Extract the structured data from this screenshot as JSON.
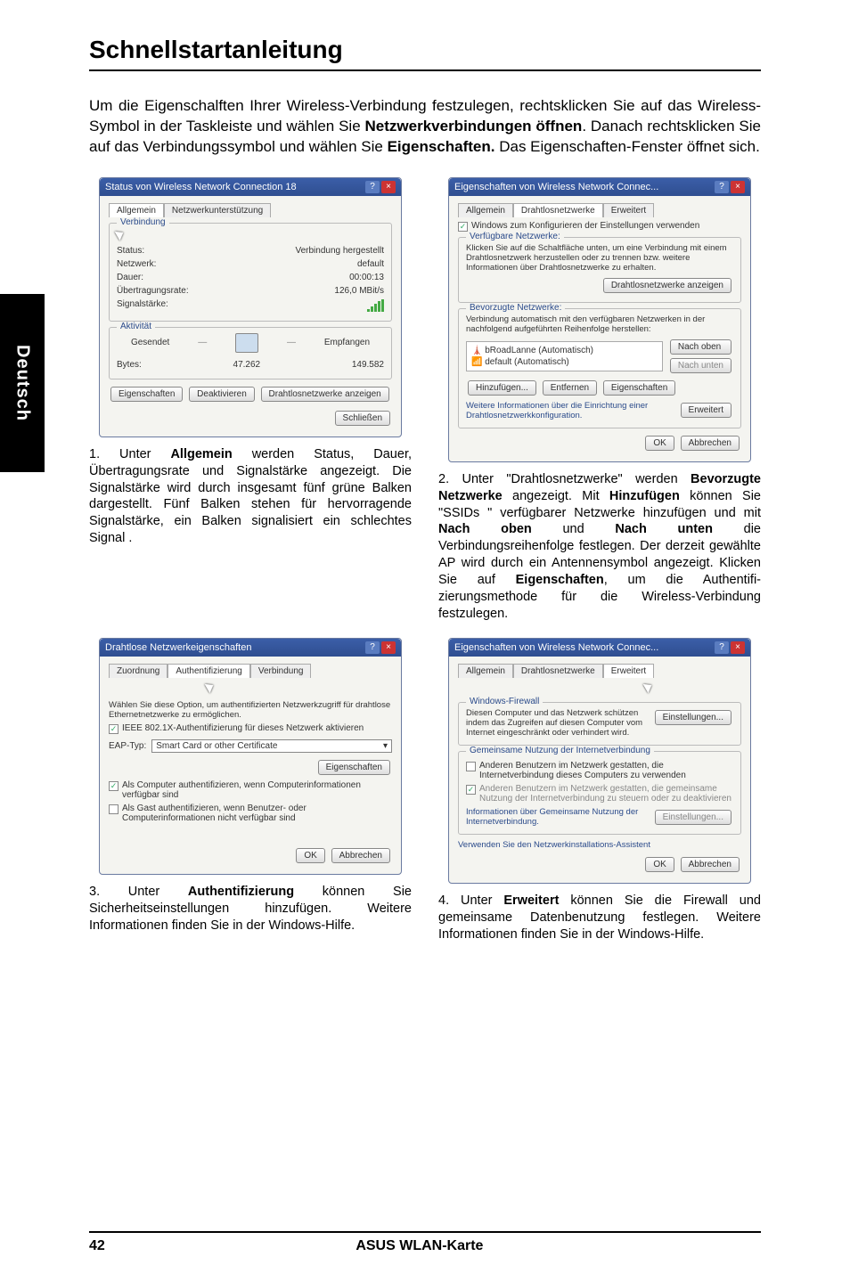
{
  "page": {
    "title": "Schnellstartanleitung",
    "sideTab": "Deutsch",
    "pageNumber": "42",
    "footerCenter": "ASUS WLAN-Karte"
  },
  "intro": {
    "p1_a": "Um die Eigenschalften Ihrer Wireless-Verbindung festzulegen, rechtsklicken Sie auf das Wireless-Symbol in der Taskleiste und wählen Sie ",
    "p1_b": "Netzwerk­verbindungen öffnen",
    "p1_c": ". Danach rechtsklicken Sie auf das Verbindungssymbol und wählen Sie ",
    "p1_d": "Eigenschaften.",
    "p1_e": " Das Eigenschaften-Fenster öffnet sich."
  },
  "dlg1": {
    "title": "Status von Wireless Network Connection 18",
    "tabs": [
      "Allgemein",
      "Netzwerkunterstützung"
    ],
    "group1": "Verbindung",
    "rows": {
      "statusL": "Status:",
      "statusV": "Verbindung hergestellt",
      "netL": "Netzwerk:",
      "netV": "default",
      "durL": "Dauer:",
      "durV": "00:00:13",
      "rateL": "Übertragungsrate:",
      "rateV": "126,0 MBit/s",
      "sigL": "Signalstärke:"
    },
    "group2": "Aktivität",
    "sent": "Gesendet",
    "recv": "Empfangen",
    "bytesL": "Bytes:",
    "bytesSent": "47.262",
    "bytesRecv": "149.582",
    "btns": {
      "props": "Eigenschaften",
      "disable": "Deaktivieren",
      "view": "Drahtlosnetzwerke anzeigen",
      "close": "Schließen"
    }
  },
  "cap1": {
    "num": "1. ",
    "a": "Unter ",
    "b": "Allgemein",
    "c": " werden Status, Dauer, Übertragungsrate und Signalstärke angezeigt. Die Signalstärke wird durch insgesamt fünf grüne Balken dargestellt. Fünf Balken stehen für hervorragende Signalstärke, ein Balken signalisiert ein schlechtes Signal ."
  },
  "dlg2": {
    "title": "Eigenschaften von Wireless Network Connec...",
    "tabs": [
      "Allgemein",
      "Drahtlosnetzwerke",
      "Erweitert"
    ],
    "chkTop": "Windows zum Konfigurieren der Einstellungen verwenden",
    "grpAvail": "Verfügbare Netzwerke:",
    "availText": "Klicken Sie auf die Schaltfläche unten, um eine Verbindung mit einem Drahtlosnetzwerk herzustellen oder zu trennen bzw. weitere Informationen über Drahtlosnetzwerke zu erhalten.",
    "btnView": "Drahtlosnetzwerke anzeigen",
    "grpPref": "Bevorzugte Netzwerke:",
    "prefText": "Verbindung automatisch mit den verfügbaren Netzwerken in der nachfolgend aufgeführten Reihenfolge herstellen:",
    "item1": "bRoadLanne (Automatisch)",
    "item2": "default (Automatisch)",
    "btnUp": "Nach oben",
    "btnDown": "Nach unten",
    "btnAdd": "Hinzufügen...",
    "btnRemove": "Entfernen",
    "btnProps": "Eigenschaften",
    "moreText": "Weitere Informationen über die Einrichtung einer Drahtlosnetzwerkkonfiguration.",
    "btnAdv": "Erweitert",
    "btnOk": "OK",
    "btnCancel": "Abbrechen"
  },
  "cap2": {
    "num": "2. ",
    "t": "Unter \"Drahtlosnetzwerke\" werden ",
    "b1": "Bevorzugte Netzwerke",
    "t2": " angezeigt. Mit ",
    "b2": "Hinzufügen",
    "t3": " können Sie \"SSIDs \" verfügbarer Netzwerke hinzufügen und mit ",
    "b3": "Nach oben",
    "t4": " und ",
    "b4": "Nach unten",
    "t5": " die Verbindungsreihenfolge festlegen. Der derzeit gewählte AP wird durch ein Antennensymbol angezeigt.  Klicken Sie auf ",
    "b5": "Eigenschaften",
    "t6": ", um die Authentifi­zierungsmethode für die Wireless-Verbindung festzulegen."
  },
  "dlg3": {
    "title": "Drahtlose Netzwerkeigenschaften",
    "tabs": [
      "Zuordnung",
      "Authentifizierung",
      "Verbindung"
    ],
    "line1": "Wählen Sie diese Option, um authentifizierten Netzwerkzugriff für drahtlose Ethernetnetzwerke zu ermöglichen.",
    "chk1": "IEEE 802.1X-Authentifizierung für dieses Netzwerk aktivieren",
    "eapL": "EAP-Typ:",
    "eapV": "Smart Card or other Certificate",
    "btnProps": "Eigenschaften",
    "chk2": "Als Computer authentifizieren, wenn Computerinformationen verfügbar sind",
    "chk3": "Als Gast authentifizieren, wenn Benutzer- oder Computerinformationen nicht verfügbar sind",
    "btnOk": "OK",
    "btnCancel": "Abbrechen"
  },
  "cap3": {
    "num": "3. ",
    "a": "Unter ",
    "b": "Authentifizierung",
    "c": " können Sie Sicherheitseinstellungen hinzufügen. Weitere Informationen finden Sie in der Windows-Hilfe."
  },
  "dlg4": {
    "title": "Eigenschaften von Wireless Network Connec...",
    "tabs": [
      "Allgemein",
      "Drahtlosnetzwerke",
      "Erweitert"
    ],
    "grpFw": "Windows-Firewall",
    "fwText": "Diesen Computer und das Netzwerk schützen indem das Zugreifen auf diesen Computer vom Internet eingeschränkt oder verhindert wird.",
    "btnFw": "Einstellungen...",
    "grpShare": "Gemeinsame Nutzung der Internetverbindung",
    "chkShare1": "Anderen Benutzern im Netzwerk gestatten, die Internetverbindung dieses Computers zu verwenden",
    "chkShare2": "Anderen Benutzern im Netzwerk gestatten, die gemeinsame Nutzung der Internetverbindung zu steuern oder zu deaktivieren",
    "linkMore": "Informationen über Gemeinsame Nutzung der Internetverbindung.",
    "btnSettings": "Einstellungen...",
    "linkWiz": "Verwenden Sie den Netzwerkinstallations-Assistent",
    "btnOk": "OK",
    "btnCancel": "Abbrechen"
  },
  "cap4": {
    "num": "4. ",
    "a": "Unter ",
    "b": "Erweitert",
    "c": " können Sie die Firewall und gemeinsame Datenbenutzung festlegen. Weitere Informationen finden Sie in der Windows-Hilfe."
  }
}
